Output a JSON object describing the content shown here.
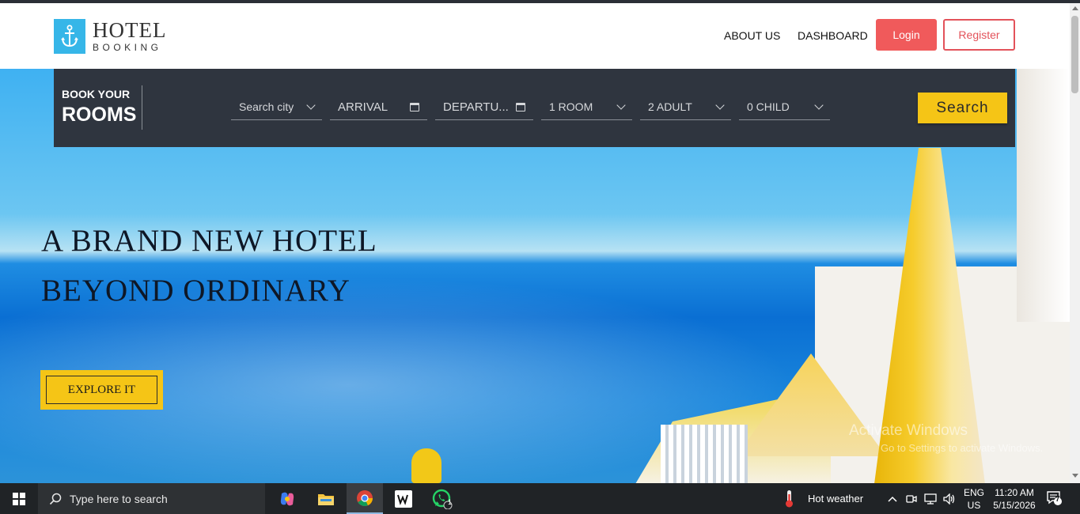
{
  "header": {
    "logo_title": "HOTEL",
    "logo_subtitle": "BOOKING",
    "nav": [
      "ABOUT US",
      "DASHBOARD"
    ],
    "login_label": "Login",
    "register_label": "Register"
  },
  "booking": {
    "heading_small": "BOOK YOUR",
    "heading_big": "ROOMS",
    "city": "Search city",
    "arrival": "ARRIVAL",
    "departure": "DEPARTU...",
    "rooms": "1 ROOM",
    "adults": "2 ADULT",
    "children": "0 CHILD",
    "search_label": "Search"
  },
  "hero": {
    "line1": "A BRAND NEW HOTEL",
    "line2": "BEYOND ORDINARY",
    "cta": "EXPLORE IT"
  },
  "watermark": {
    "title": "Activate Windows",
    "subtitle": "Go to Settings to activate Windows."
  },
  "taskbar": {
    "search_placeholder": "Type here to search",
    "weather": "Hot weather",
    "lang_top": "ENG",
    "lang_bottom": "US",
    "time": "11:20 AM",
    "date": "5/15/2026",
    "whatsapp_badge": "1",
    "notifications_count": "7"
  },
  "colors": {
    "accent_yellow": "#f5c516",
    "login_red": "#f05a5b",
    "booking_bar": "#2f353f",
    "logo_blue": "#36b6e8"
  }
}
